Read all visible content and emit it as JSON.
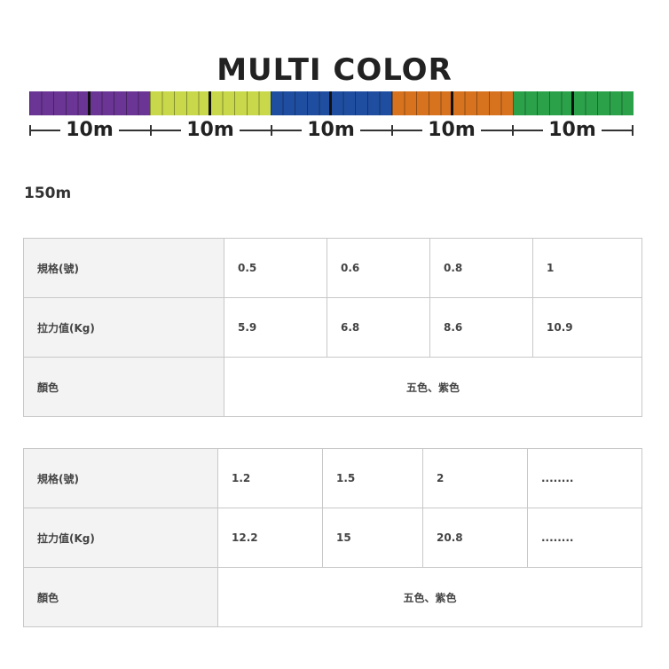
{
  "banner": {
    "title": "MULTI COLOR",
    "segments": [
      {
        "color": "#6a3594",
        "label": "10m"
      },
      {
        "color": "#c8d84a",
        "label": "10m"
      },
      {
        "color": "#1f4ea0",
        "label": "10m"
      },
      {
        "color": "#d7731f",
        "label": "10m"
      },
      {
        "color": "#2ba14a",
        "label": "10m"
      }
    ]
  },
  "length": "150m",
  "tables": [
    {
      "rows": [
        {
          "header": "規格(號)",
          "cells": [
            "0.5",
            "0.6",
            "0.8",
            "1"
          ]
        },
        {
          "header": "拉力值(Kg)",
          "cells": [
            "5.9",
            "6.8",
            "8.6",
            "10.9"
          ]
        },
        {
          "header": "顏色",
          "merged": "五色、紫色"
        }
      ]
    },
    {
      "rows": [
        {
          "header": "規格(號)",
          "cells": [
            "1.2",
            "1.5",
            "2",
            "........"
          ]
        },
        {
          "header": "拉力值(Kg)",
          "cells": [
            "12.2",
            "15",
            "20.8",
            "........"
          ]
        },
        {
          "header": "顏色",
          "merged": "五色、紫色"
        }
      ]
    }
  ]
}
